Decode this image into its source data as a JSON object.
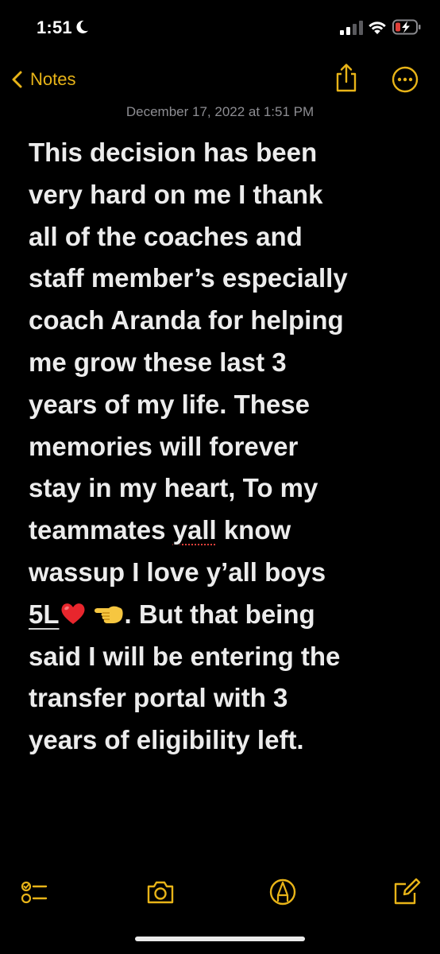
{
  "status_bar": {
    "time": "1:51",
    "focus_icon": "moon-icon",
    "signal_icon": "cellular-signal-icon",
    "wifi_icon": "wifi-icon",
    "battery_icon": "battery-low-charging-icon"
  },
  "nav": {
    "back_label": "Notes",
    "share_icon": "share-icon",
    "more_icon": "more-options-icon"
  },
  "note": {
    "date": "December 17, 2022 at 1:51 PM",
    "lines": {
      "l1": "This decision has been",
      "l2": "very hard on me I thank",
      "l3": "all of the coaches and",
      "l4": "staff member’s especially",
      "l5": "coach Aranda for helping",
      "l6": "me grow these last 3",
      "l7": "years of my life. These",
      "l8": "memories will forever",
      "l9": "stay in my heart,  To my",
      "l10_pre": "teammates ",
      "l10_spell": "yall",
      "l10_post": " know",
      "l11": "wassup I love y’all boys",
      "l12_fivel": "5L",
      "l12_post": ". But that being",
      "l13": "said I will be entering the",
      "l14": "transfer portal with 3",
      "l15": "years of eligibility left."
    },
    "emoji_heart": "red-heart-emoji",
    "emoji_hand": "backhand-index-pointing-left-emoji"
  },
  "toolbar": {
    "checklist_icon": "checklist-icon",
    "camera_icon": "camera-icon",
    "markup_icon": "markup-pen-icon",
    "compose_icon": "compose-icon"
  },
  "colors": {
    "accent": "#e8b418",
    "background": "#000000",
    "text": "#ececec",
    "date": "#8d8d92",
    "battery_low": "#e0403a"
  }
}
